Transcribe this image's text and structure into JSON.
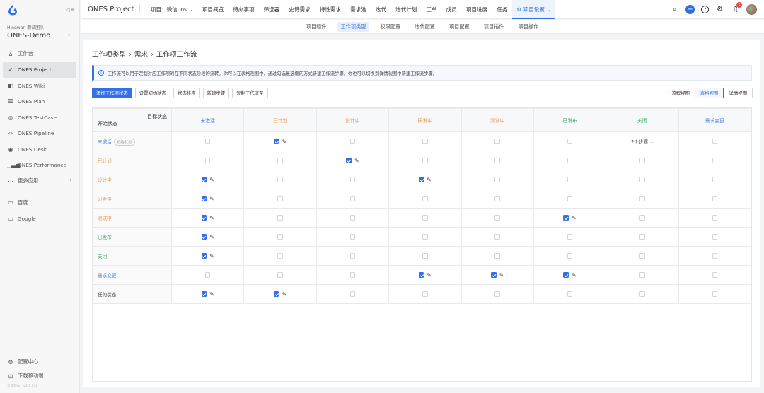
{
  "sidebar": {
    "team_label": "Hingwan 测试团队",
    "org_name": "ONES-Demo",
    "items": [
      {
        "label": "工作台",
        "icon": "home-icon"
      },
      {
        "label": "ONES Project",
        "icon": "rocket-icon",
        "active": true
      },
      {
        "label": "ONES Wiki",
        "icon": "book-icon"
      },
      {
        "label": "ONES Plan",
        "icon": "plan-icon"
      },
      {
        "label": "ONES TestCase",
        "icon": "testcase-icon"
      },
      {
        "label": "ONES Pipeline",
        "icon": "pipeline-icon"
      },
      {
        "label": "ONES Desk",
        "icon": "desk-icon"
      },
      {
        "label": "ONES Performance",
        "icon": "bar-chart-icon"
      },
      {
        "label": "更多应用",
        "icon": "more-icon"
      }
    ],
    "links": [
      {
        "label": "百度",
        "icon": "bookmark-icon"
      },
      {
        "label": "Google",
        "icon": "bookmark-icon"
      }
    ],
    "bottom": [
      {
        "label": "配置中心",
        "icon": "gear-icon"
      },
      {
        "label": "下载移动端",
        "icon": "download-icon"
      }
    ],
    "version": "当前版本：v3.3.138"
  },
  "topbar": {
    "title": "ONES Project",
    "project_select": "项目：微信 ios",
    "nav": [
      "项目概览",
      "待办事项",
      "筛选器",
      "史诗需求",
      "特性需求",
      "需求池",
      "迭代",
      "迭代计划",
      "工单",
      "成员",
      "项目进度",
      "任务"
    ],
    "settings": "项目设置",
    "notification_count": "1"
  },
  "subnav": {
    "items": [
      "项目组件",
      "工作项类型",
      "权限配置",
      "迭代配置",
      "项目配置",
      "项目插件",
      "项目操作"
    ],
    "active": "工作项类型"
  },
  "breadcrumb": [
    "工作项类型",
    "需求",
    "工作项工作流"
  ],
  "notice": "工作流可以用于定制对应工作项的在不同状态阶段的流转。你可以在表格视图中，通过勾选复选框的方式新建工作流步骤。你也可以切换到详情视图中新建工作流步骤。",
  "toolbar": {
    "add": "添加工作项状态",
    "init": "设置初始状态",
    "sort": "状态排序",
    "new_step": "新建步骤",
    "copy": "复制工作流至"
  },
  "views": {
    "flow": "流程视图",
    "table": "表格视图",
    "detail": "详情视图",
    "active": "表格视图"
  },
  "table": {
    "corner_target": "目标状态",
    "corner_start": "开始状态",
    "columns": [
      {
        "label": "未激活",
        "color": "#4b7fd8"
      },
      {
        "label": "已计划",
        "color": "#e79b52"
      },
      {
        "label": "设计中",
        "color": "#e79b52"
      },
      {
        "label": "研发中",
        "color": "#e79b52"
      },
      {
        "label": "测试中",
        "color": "#e79b52"
      },
      {
        "label": "已发布",
        "color": "#46a868"
      },
      {
        "label": "关闭",
        "color": "#46a868"
      },
      {
        "label": "需求变更",
        "color": "#4b7fd8"
      }
    ],
    "rows": [
      {
        "label": "未激活",
        "tag": "初始状态",
        "color": "#4b7fd8",
        "cells": [
          0,
          1,
          0,
          0,
          0,
          0,
          "2个步骤",
          0
        ]
      },
      {
        "label": "已计划",
        "color": "#e79b52",
        "cells": [
          0,
          0,
          1,
          0,
          0,
          0,
          0,
          0
        ]
      },
      {
        "label": "设计中",
        "color": "#e79b52",
        "cells": [
          1,
          0,
          0,
          1,
          0,
          0,
          0,
          0
        ]
      },
      {
        "label": "研发中",
        "color": "#e79b52",
        "cells": [
          1,
          0,
          0,
          0,
          0,
          0,
          0,
          0
        ]
      },
      {
        "label": "测试中",
        "color": "#e79b52",
        "cells": [
          1,
          0,
          0,
          0,
          0,
          1,
          0,
          0
        ]
      },
      {
        "label": "已发布",
        "color": "#46a868",
        "cells": [
          1,
          0,
          0,
          0,
          0,
          0,
          0,
          0
        ]
      },
      {
        "label": "关闭",
        "color": "#46a868",
        "cells": [
          1,
          0,
          0,
          0,
          0,
          0,
          0,
          0
        ]
      },
      {
        "label": "需求变更",
        "color": "#4b7fd8",
        "cells": [
          0,
          0,
          0,
          1,
          1,
          1,
          0,
          0
        ]
      },
      {
        "label": "任何状态",
        "color": "#333333",
        "cells": [
          1,
          1,
          0,
          0,
          0,
          0,
          0,
          0
        ]
      }
    ]
  }
}
